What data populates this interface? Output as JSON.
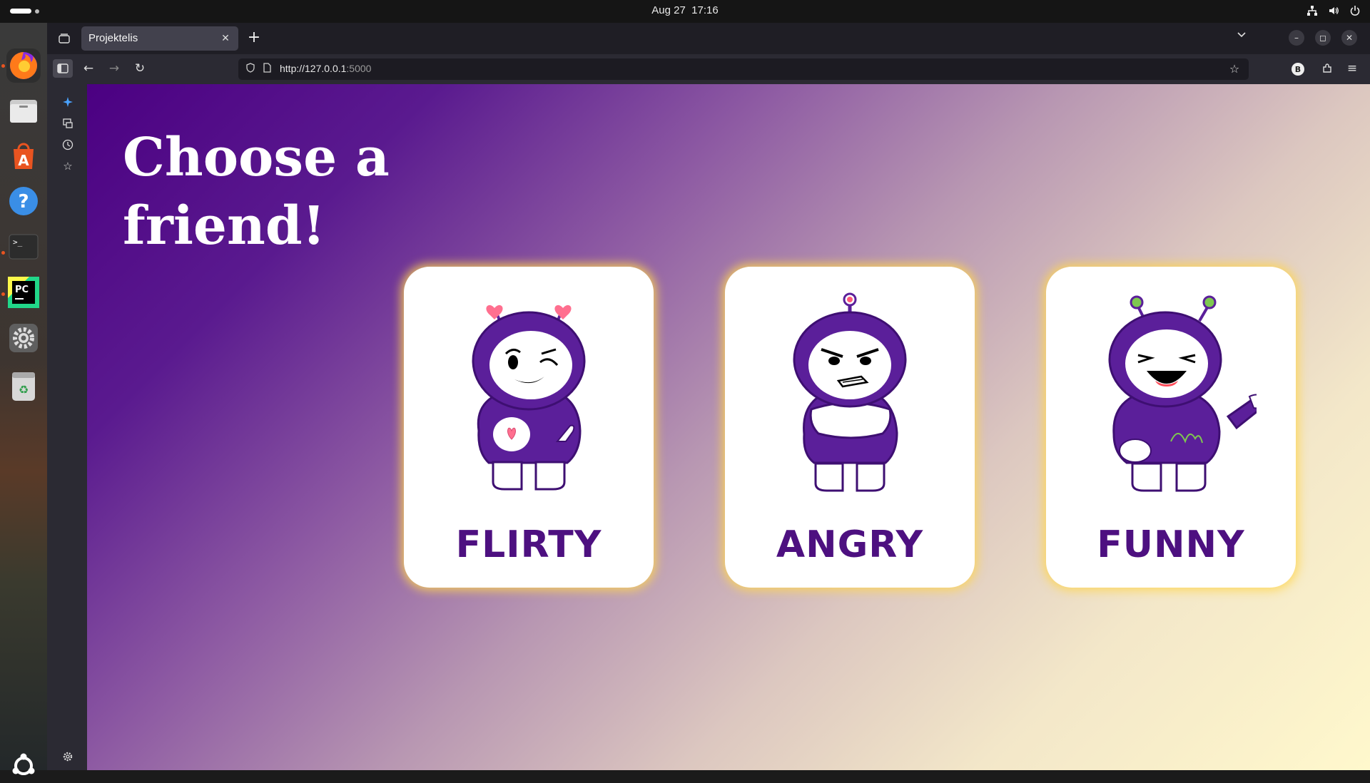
{
  "system": {
    "date": "Aug 27",
    "time": "17:16"
  },
  "browser": {
    "tab_title": "Projektelis",
    "url_host": "http://127.0.0.1",
    "url_port": ":5000"
  },
  "page": {
    "title": "Choose a friend!",
    "cards": [
      {
        "label": "FLIRTY",
        "icon": "flirty-robot-icon"
      },
      {
        "label": "ANGRY",
        "icon": "angry-robot-icon"
      },
      {
        "label": "FUNNY",
        "icon": "funny-robot-icon"
      }
    ]
  },
  "colors": {
    "gradient_start": "#4b0082",
    "gradient_end": "#fff8cc",
    "card_label": "#4d1080",
    "card_glow": "#ffd650",
    "robot_purple": "#5b1f9a"
  },
  "dock_icons": [
    "firefox-icon",
    "files-icon",
    "app-center-icon",
    "help-icon",
    "terminal-icon",
    "pycharm-icon",
    "settings-icon",
    "trash-icon",
    "show-apps-icon"
  ]
}
